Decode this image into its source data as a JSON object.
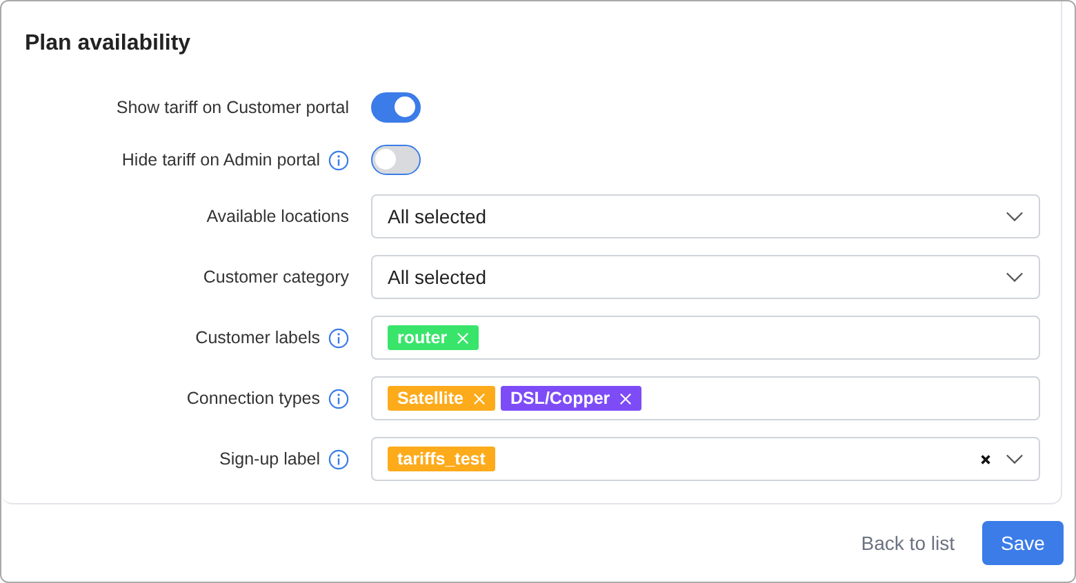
{
  "card": {
    "title": "Plan availability"
  },
  "fields": [
    {
      "kind": "toggle",
      "label": "Show tariff on Customer portal",
      "info": false,
      "on": true
    },
    {
      "kind": "toggle",
      "label": "Hide tariff on Admin portal",
      "info": true,
      "on": false
    },
    {
      "kind": "select",
      "label": "Available locations",
      "info": false,
      "value": "All selected"
    },
    {
      "kind": "select",
      "label": "Customer category",
      "info": false,
      "value": "All selected"
    },
    {
      "kind": "tags",
      "label": "Customer labels",
      "info": true,
      "tags": [
        {
          "text": "router",
          "color": "#39e46a",
          "removable": true
        }
      ]
    },
    {
      "kind": "tags",
      "label": "Connection types",
      "info": true,
      "tags": [
        {
          "text": "Satellite",
          "color": "#fdab1b",
          "removable": true
        },
        {
          "text": "DSL/Copper",
          "color": "#7d4cf7",
          "removable": true
        }
      ]
    },
    {
      "kind": "tags",
      "label": "Sign-up label",
      "info": true,
      "clearable": true,
      "dropdown": true,
      "tags": [
        {
          "text": "tariffs_test",
          "color": "#fdab1b",
          "removable": false
        }
      ]
    }
  ],
  "footer": {
    "back": "Back to list",
    "save": "Save"
  }
}
